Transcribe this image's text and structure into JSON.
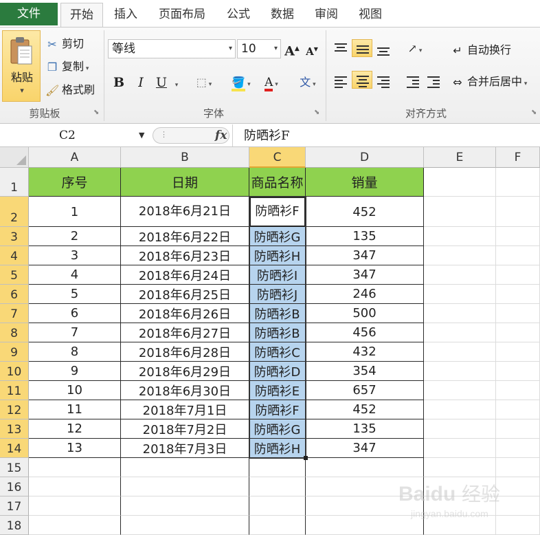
{
  "tabs": {
    "file": "文件",
    "items": [
      "开始",
      "插入",
      "页面布局",
      "公式",
      "数据",
      "审阅",
      "视图"
    ],
    "active": "开始"
  },
  "clipboard": {
    "paste": "粘贴",
    "cut": "剪切",
    "copy": "复制",
    "format_painter": "格式刷",
    "group_label": "剪贴板"
  },
  "font": {
    "name": "等线",
    "size": "10",
    "bold": "B",
    "italic": "I",
    "underline": "U",
    "font_color_label": "A",
    "group_label": "字体",
    "accent_fill": "#f7e34c",
    "accent_font": "#e0201e"
  },
  "alignment": {
    "wrap_text": "自动换行",
    "merge_center": "合并后居中",
    "group_label": "对齐方式"
  },
  "formula_bar": {
    "name_box": "C2",
    "fx": "fx",
    "content": "防晒衫F"
  },
  "sheet": {
    "columns": [
      "A",
      "B",
      "C",
      "D",
      "E",
      "F"
    ],
    "selected_column": "C",
    "row_numbers": [
      "1",
      "2",
      "3",
      "4",
      "5",
      "6",
      "7",
      "8",
      "9",
      "10",
      "11",
      "12",
      "13",
      "14",
      "15",
      "16",
      "17",
      "18"
    ],
    "selected_rows": [
      "2",
      "3",
      "4",
      "5",
      "6",
      "7",
      "8",
      "9",
      "10",
      "11",
      "12",
      "13",
      "14"
    ],
    "headers": [
      "序号",
      "日期",
      "商品名称",
      "销量"
    ],
    "rows": [
      [
        "1",
        "2018年6月21日",
        "防晒衫F",
        "452"
      ],
      [
        "2",
        "2018年6月22日",
        "防晒衫G",
        "135"
      ],
      [
        "3",
        "2018年6月23日",
        "防晒衫H",
        "347"
      ],
      [
        "4",
        "2018年6月24日",
        "防晒衫I",
        "347"
      ],
      [
        "5",
        "2018年6月25日",
        "防晒衫J",
        "246"
      ],
      [
        "6",
        "2018年6月26日",
        "防晒衫B",
        "500"
      ],
      [
        "7",
        "2018年6月27日",
        "防晒衫B",
        "456"
      ],
      [
        "8",
        "2018年6月28日",
        "防晒衫C",
        "432"
      ],
      [
        "9",
        "2018年6月29日",
        "防晒衫D",
        "354"
      ],
      [
        "10",
        "2018年6月30日",
        "防晒衫E",
        "657"
      ],
      [
        "11",
        "2018年7月1日",
        "防晒衫F",
        "452"
      ],
      [
        "12",
        "2018年7月2日",
        "防晒衫G",
        "135"
      ],
      [
        "13",
        "2018年7月3日",
        "防晒衫H",
        "347"
      ]
    ],
    "header_fill": "#8fd24f",
    "highlight_fill": "#b7d4ee",
    "selection_header_fill": "#f9d877"
  },
  "watermark": {
    "brand": "Baidu",
    "text": "经验",
    "url": "jingyan.baidu.com"
  }
}
